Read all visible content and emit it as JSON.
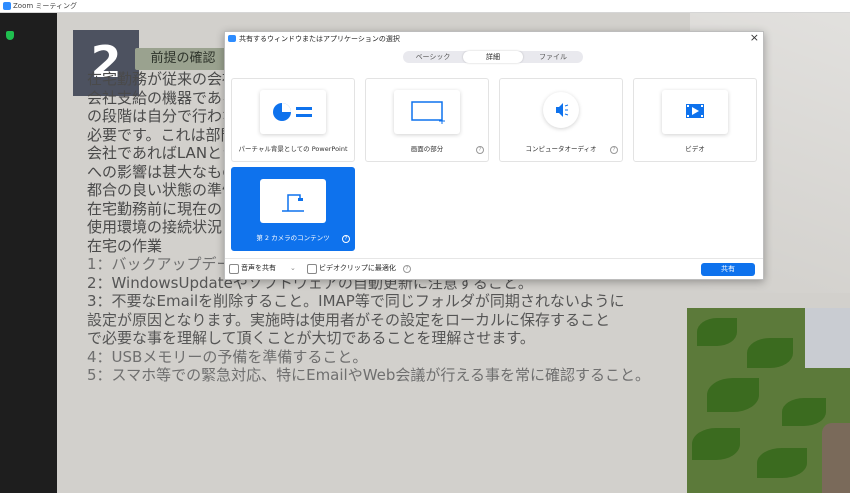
{
  "window": {
    "title": "Zoom ミーティング"
  },
  "slide": {
    "number": "2",
    "heading": "前提の確認",
    "lines": [
      "在宅勤務が従来の会社業務と大きく異なるのは、                                   です。同一",
      "会社支給の機器であるとは限らない",
      "の段階は自分で行わなければならない",
      "必要です。これは部門の",
      "会社であればLANとシステムの",
      "への影響は甚大なものとなり",
      "都合の良い状態の準備",
      "在宅勤務前に現在の",
      "使用環境の接続状況",
      "在宅の作業",
      "1：バックアップデータ",
      "2：WindowsUpdateやソフトウェアの自動更新に注意すること。",
      "3：不要なEmailを削除すること。IMAP等で同じフォルダが同期されないように",
      "設定が原因となります。実施時は使用者がその設定をローカルに保存すること",
      "で必要な事を理解して頂くことが大切であることを理解させます。",
      "4：USBメモリーの予備を準備すること。",
      "5：スマホ等での緊急対応、特にEmailやWeb会議が行える事を常に確認すること。"
    ]
  },
  "dialog": {
    "title": "共有するウィンドウまたはアプリケーションの選択",
    "close": "×",
    "tabs": [
      "ベーシック",
      "詳細",
      "ファイル"
    ],
    "active_tab": "詳細",
    "options": [
      {
        "label": "パーチャル背景としての PowerPoint",
        "icon": "powerpoint-background-icon",
        "help": false
      },
      {
        "label": "画面の部分",
        "icon": "screen-portion-icon",
        "help": true
      },
      {
        "label": "コンピュータオーディオ",
        "icon": "computer-audio-icon",
        "help": true
      },
      {
        "label": "ビデオ",
        "icon": "video-icon",
        "help": false
      },
      {
        "label": "第 2 カメラのコンテンツ",
        "icon": "second-camera-icon",
        "help": true,
        "selected": true
      }
    ],
    "footer": {
      "share_audio": "音声を共有",
      "optimize_video": "ビデオクリップに最適化",
      "share_button": "共有",
      "help": "?"
    }
  },
  "colors": {
    "accent": "#0e72ed",
    "zoom_blue": "#2d8cff"
  }
}
